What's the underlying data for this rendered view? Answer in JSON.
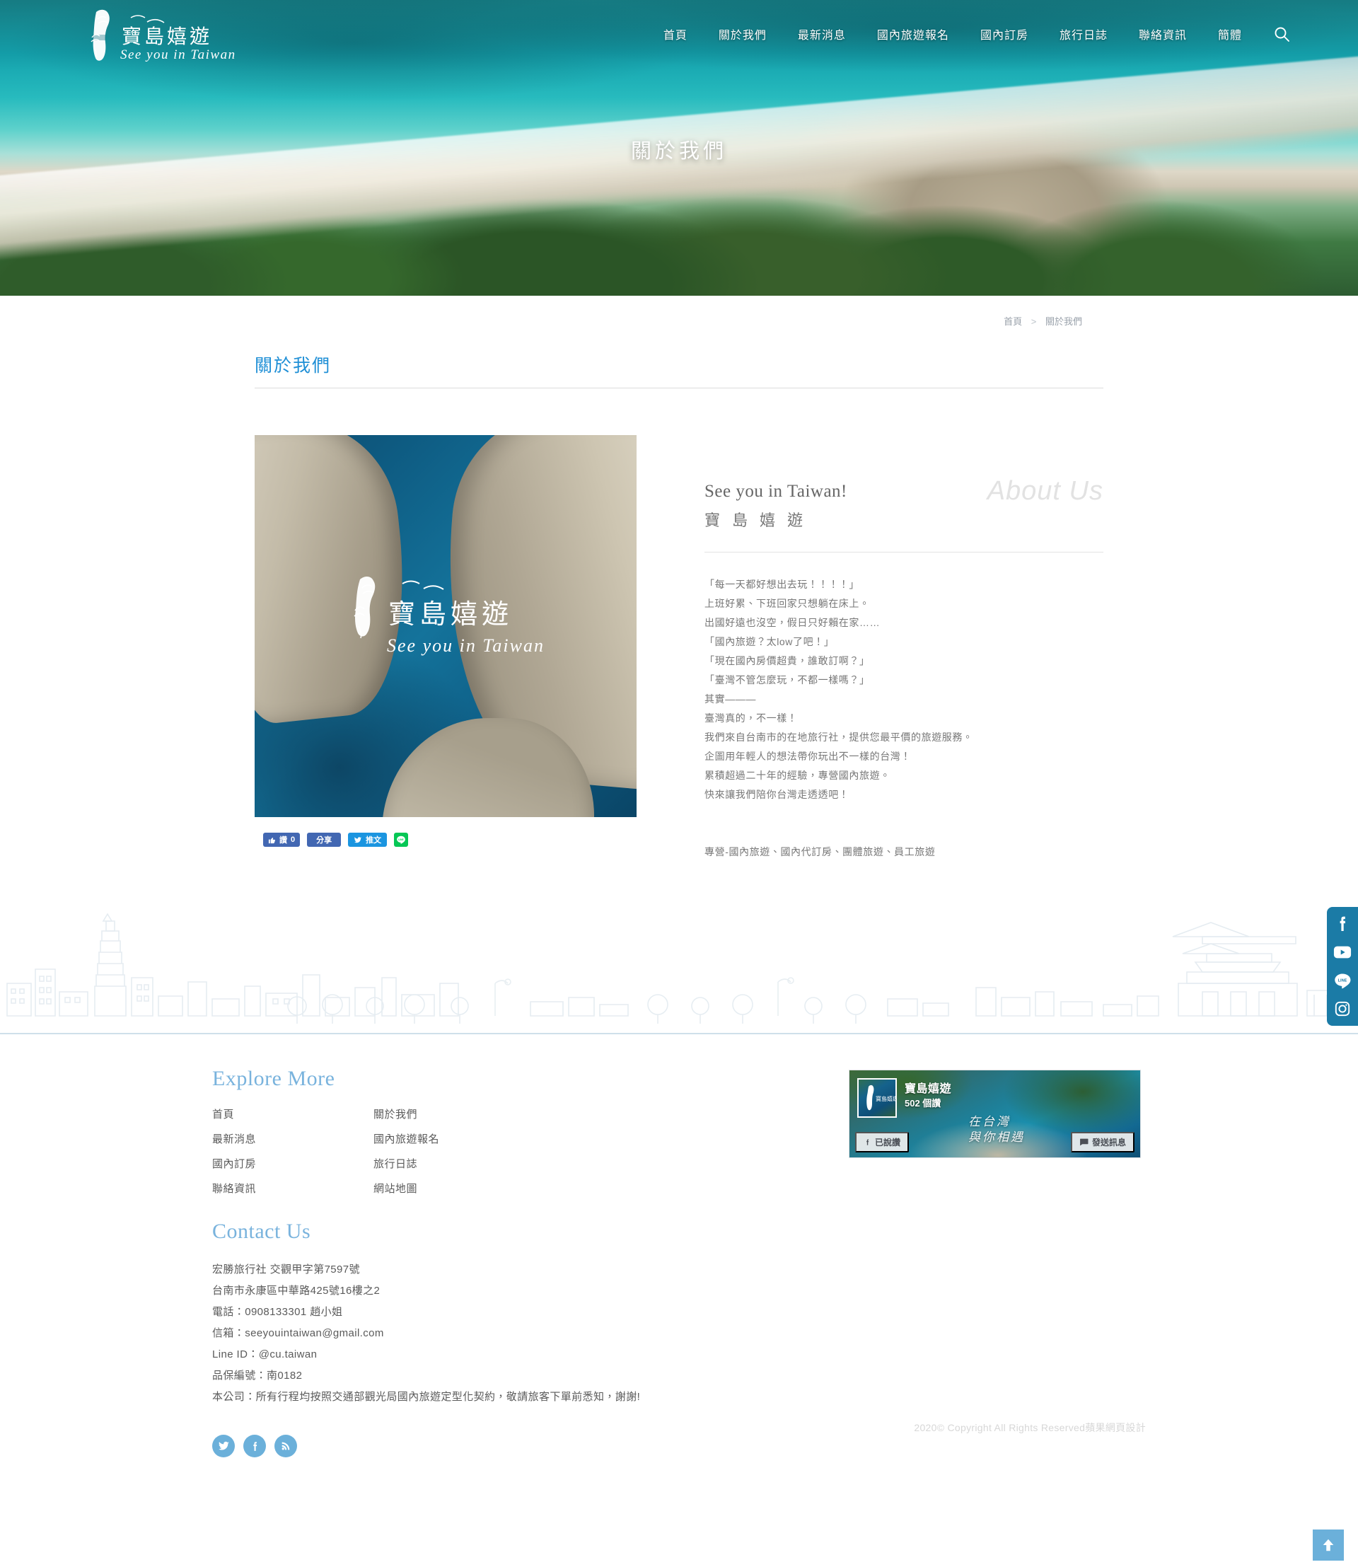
{
  "site": {
    "logo_zh": "寶島嬉遊",
    "logo_en": "See you in Taiwan",
    "colors": {
      "accent_blue": "#1f8fd6",
      "footer_heading": "#79b3dd",
      "social_panel": "#1b7ba6",
      "circle_social": "#6bb0da"
    }
  },
  "nav": {
    "items": [
      {
        "label": "首頁"
      },
      {
        "label": "關於我們"
      },
      {
        "label": "最新消息"
      },
      {
        "label": "國內旅遊報名"
      },
      {
        "label": "國內訂房"
      },
      {
        "label": "旅行日誌"
      },
      {
        "label": "聯絡資訊"
      },
      {
        "label": "簡體"
      }
    ],
    "search_icon": "search-icon"
  },
  "hero": {
    "title": "關於我們"
  },
  "breadcrumb": {
    "home": "首頁",
    "separator": ">",
    "current": "關於我們"
  },
  "page": {
    "title": "關於我們"
  },
  "about": {
    "en_title": "See you in Taiwan!",
    "zh_title": "寶島嬉遊",
    "watermark": "About Us",
    "photo_brand_zh": "寶島嬉遊",
    "photo_brand_en": "See you in Taiwan",
    "body_lines": [
      "「每一天都好想出去玩！！！！」",
      "上班好累、下班回家只想躺在床上。",
      "出國好遠也沒空，假日只好賴在家……",
      "「國內旅遊？太low了吧！」",
      "「現在國內房價超貴，誰敢訂啊？」",
      "「臺灣不管怎麼玩，不都一樣嗎？」",
      "其實———",
      "臺灣真的，不一樣！",
      "我們來自台南市的在地旅行社，提供您最平價的旅遊服務。",
      "企圖用年輕人的想法帶你玩出不一樣的台灣！",
      "累積超過二十年的經驗，專營國內旅遊。",
      "快來讓我們陪你台灣走透透吧！"
    ],
    "body_footer": "專營-國內旅遊、國內代訂房、團體旅遊、員工旅遊"
  },
  "share": {
    "like_label": "讚",
    "like_count": "0",
    "share_label": "分享",
    "tweet_label": "推文",
    "line_label": "LINE"
  },
  "footer": {
    "explore_title": "Explore More",
    "explore_links": [
      {
        "label": "首頁"
      },
      {
        "label": "關於我們"
      },
      {
        "label": "最新消息"
      },
      {
        "label": "國內旅遊報名"
      },
      {
        "label": "國內訂房"
      },
      {
        "label": "旅行日誌"
      },
      {
        "label": "聯絡資訊"
      },
      {
        "label": "網站地圖"
      }
    ],
    "contact_title": "Contact Us",
    "contact_lines": [
      "宏勝旅行社 交觀甲字第7597號",
      "台南市永康區中華路425號16樓之2",
      "電話：0908133301 趙小姐",
      "信箱：seeyouintaiwan@gmail.com",
      "Line ID：@cu.taiwan",
      "品保編號：南0182",
      "本公司：所有行程均按照交通部觀光局國內旅遊定型化契約，敬請旅客下單前悉知，謝謝!"
    ],
    "social": [
      {
        "name": "twitter-icon"
      },
      {
        "name": "facebook-icon"
      },
      {
        "name": "rss-icon"
      }
    ],
    "copyright": "2020© Copyright All Rights Reserved蘋果網頁設計"
  },
  "fb_widget": {
    "page_name": "寶島嬉遊",
    "likes": "502 個讚",
    "liked_button": "已說讚",
    "message_button": "發送訊息",
    "cover_text_line1": "在台灣",
    "cover_text_line2": "與你相遇"
  },
  "float_social": [
    {
      "name": "facebook-icon"
    },
    {
      "name": "youtube-icon"
    },
    {
      "name": "line-icon"
    },
    {
      "name": "instagram-icon"
    }
  ],
  "gotop": {
    "name": "scroll-to-top"
  }
}
